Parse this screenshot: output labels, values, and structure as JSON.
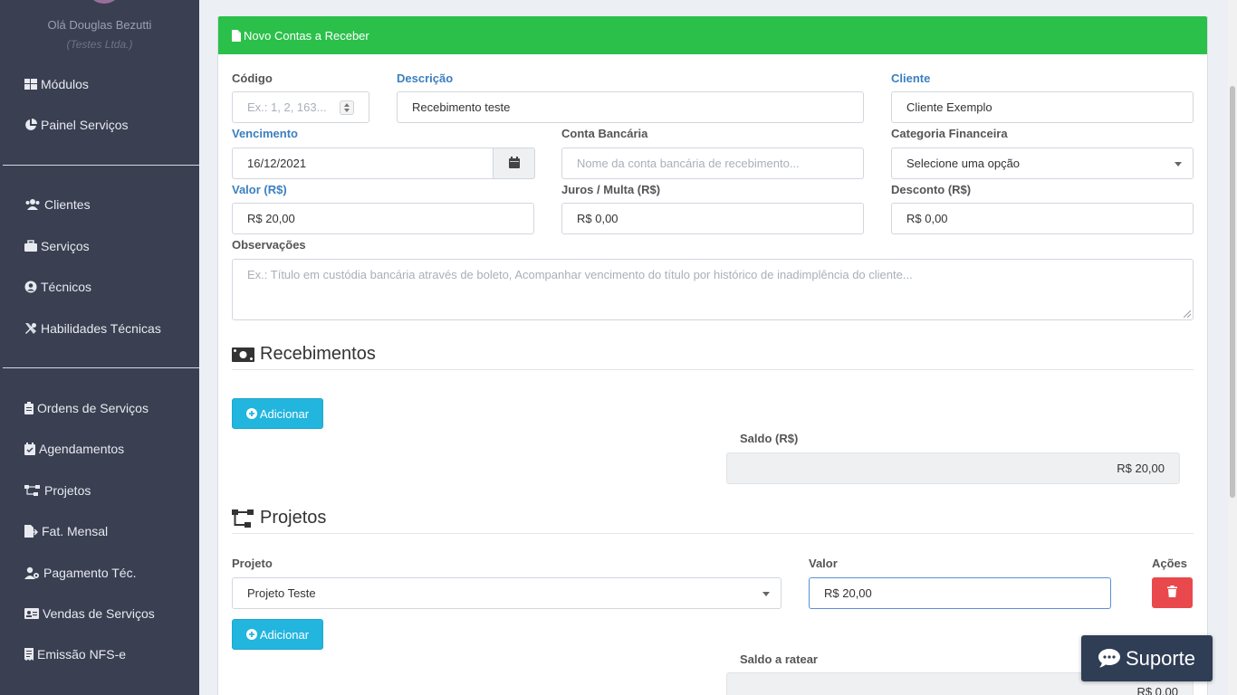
{
  "sidebar": {
    "greeting": "Olá Douglas Bezutti",
    "company": "(Testes Ltda.)",
    "items": [
      {
        "label": "Módulos",
        "icon": "grid-icon"
      },
      {
        "label": "Painel Serviços",
        "icon": "pie-chart-icon"
      },
      {
        "label": "Clientes",
        "icon": "users-icon"
      },
      {
        "label": "Serviços",
        "icon": "briefcase-icon"
      },
      {
        "label": "Técnicos",
        "icon": "user-circle-icon"
      },
      {
        "label": "Habilidades Técnicas",
        "icon": "tools-icon"
      },
      {
        "label": "Ordens de Serviços",
        "icon": "clipboard-icon"
      },
      {
        "label": "Agendamentos",
        "icon": "calendar-check-icon"
      },
      {
        "label": "Projetos",
        "icon": "sitemap-icon"
      },
      {
        "label": "Fat. Mensal",
        "icon": "file-export-icon"
      },
      {
        "label": "Pagamento Téc.",
        "icon": "user-cog-icon"
      },
      {
        "label": "Vendas de Serviços",
        "icon": "id-card-icon"
      },
      {
        "label": "Emissão NFS-e",
        "icon": "receipt-icon"
      }
    ]
  },
  "panel": {
    "title": "Novo Contas a Receber",
    "header_color": "#2bc04a"
  },
  "form": {
    "codigo": {
      "label": "Código",
      "placeholder": "Ex.: 1, 2, 163..."
    },
    "descricao": {
      "label": "Descrição",
      "value": "Recebimento teste"
    },
    "cliente": {
      "label": "Cliente",
      "value": "Cliente Exemplo"
    },
    "vencimento": {
      "label": "Vencimento",
      "value": "16/12/2021"
    },
    "conta_bancaria": {
      "label": "Conta Bancária",
      "placeholder": "Nome da conta bancária de recebimento..."
    },
    "categoria": {
      "label": "Categoria Financeira",
      "value": "Selecione uma opção"
    },
    "valor": {
      "label": "Valor (R$)",
      "value": "R$ 20,00"
    },
    "juros": {
      "label": "Juros / Multa (R$)",
      "value": "R$ 0,00"
    },
    "desconto": {
      "label": "Desconto (R$)",
      "value": "R$ 0,00"
    },
    "observacoes": {
      "label": "Observações",
      "placeholder": "Ex.: Título em custódia bancária através de boleto, Acompanhar vencimento do título por histórico de inadimplência do cliente..."
    }
  },
  "recebimentos": {
    "title": "Recebimentos",
    "add_label": "Adicionar",
    "saldo_label": "Saldo (R$)",
    "saldo_value": "R$ 20,00"
  },
  "projetos": {
    "title": "Projetos",
    "col_projeto": "Projeto",
    "col_valor": "Valor",
    "col_acoes": "Ações",
    "row": {
      "projeto": "Projeto Teste",
      "valor": "R$ 20,00"
    },
    "add_label": "Adicionar",
    "saldo_label": "Saldo a ratear",
    "saldo_value": "R$ 0,00"
  },
  "support": {
    "label": "Suporte"
  },
  "colors": {
    "sidebar": "#3a3f51",
    "accent_blue": "#3c7fbf",
    "info": "#22b5de",
    "danger": "#e9494d",
    "support": "#2f3d55"
  }
}
